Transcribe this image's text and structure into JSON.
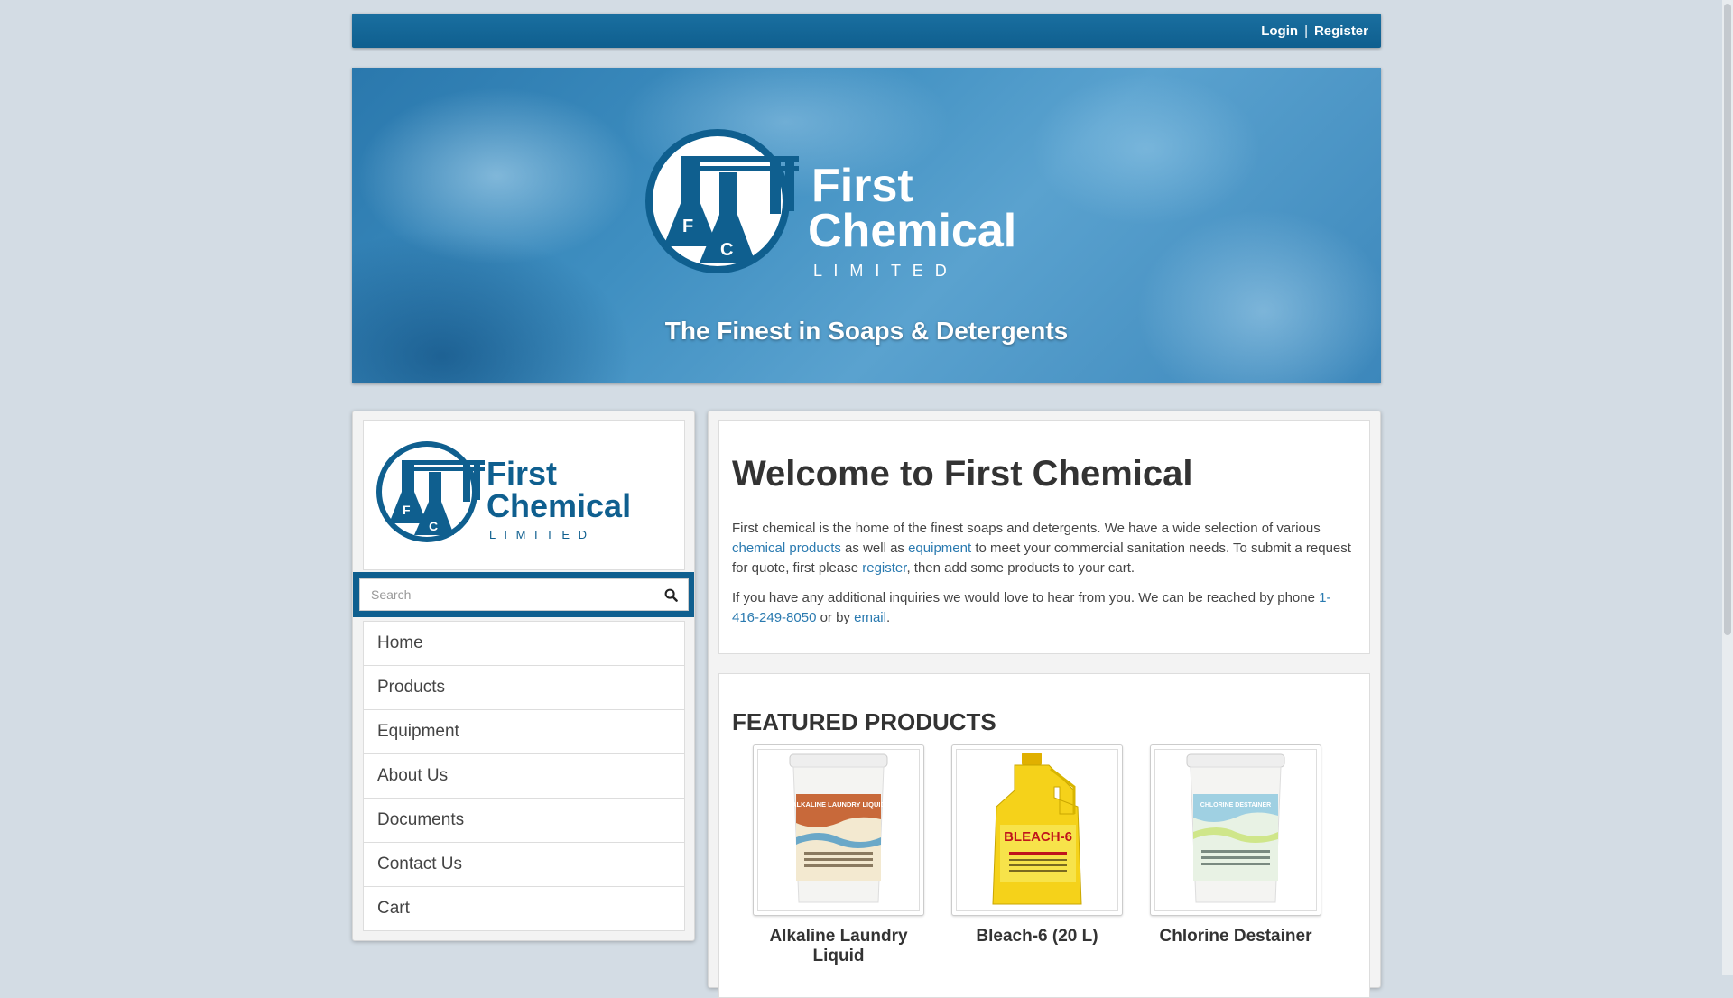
{
  "header": {
    "login_label": "Login",
    "separator": "|",
    "register_label": "Register"
  },
  "banner": {
    "logo_word1": "First",
    "logo_word2": "Chemical",
    "logo_word3": "L I M I T E D",
    "logo_letter_f": "F",
    "logo_letter_c": "C",
    "tagline": "The Finest in Soaps & Detergents"
  },
  "sidebar": {
    "logo_word1": "First",
    "logo_word2": "Chemical",
    "logo_word3": "L I M I T E D",
    "search_placeholder": "Search",
    "nav": [
      "Home",
      "Products",
      "Equipment",
      "About Us",
      "Documents",
      "Contact Us",
      "Cart"
    ]
  },
  "welcome": {
    "title": "Welcome to First Chemical",
    "p1_a": "First chemical is the home of the finest soaps and detergents. We have a wide selection of various ",
    "p1_link1": "chemical products",
    "p1_b": " as well as ",
    "p1_link2": "equipment",
    "p1_c": " to meet your commercial sanitation needs. To submit a request for quote, first please ",
    "p1_link3": "register",
    "p1_d": ", then add some products to your cart.",
    "p2_a": "If you have any additional inquiries we would love to hear from you. We can be reached by phone ",
    "p2_phone": "1-416-249-8050",
    "p2_b": " or by ",
    "p2_email": "email",
    "p2_c": "."
  },
  "featured": {
    "heading": "FEATURED PRODUCTS",
    "products": [
      {
        "name": "Alkaline Laundry Liquid",
        "label": "ALKALINE LAUNDRY LIQUID"
      },
      {
        "name": "Bleach-6 (20 L)",
        "label": "BLEACH-6"
      },
      {
        "name": "Chlorine Destainer",
        "label": "CHLORINE DESTAINER"
      }
    ]
  },
  "colors": {
    "brand_blue": "#0f5f8f",
    "link_blue": "#2a7ab0",
    "page_bg": "#d3dce4"
  }
}
